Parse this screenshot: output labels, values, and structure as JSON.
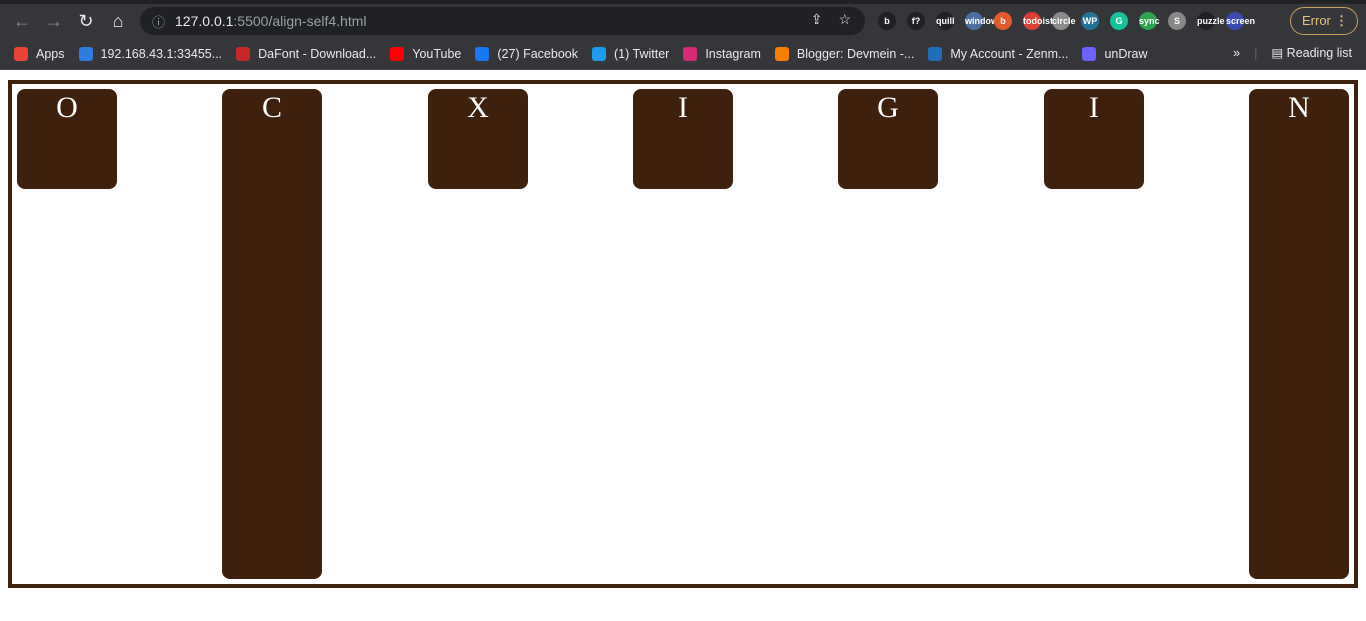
{
  "browser": {
    "url_host": "127.0.0.1",
    "url_path": ":5500/align-self4.html",
    "error_label": "Error",
    "extensions": [
      "b",
      "f?",
      "quill",
      "window",
      "b",
      "todoist",
      "circle",
      "WP",
      "G",
      "sync",
      "S",
      "puzzle",
      "screen"
    ],
    "bookmarks": [
      {
        "label": "Apps",
        "icon": "apps-grid-icon",
        "color": "#ea4335"
      },
      {
        "label": "192.168.43.1:33455...",
        "icon": "xender-icon",
        "color": "#2f7de1"
      },
      {
        "label": "DaFont - Download...",
        "icon": "dafont-icon",
        "color": "#c62828"
      },
      {
        "label": "YouTube",
        "icon": "youtube-icon",
        "color": "#ff0000"
      },
      {
        "label": "(27) Facebook",
        "icon": "facebook-icon",
        "color": "#1877f2"
      },
      {
        "label": "(1) Twitter",
        "icon": "twitter-icon",
        "color": "#1d9bf0"
      },
      {
        "label": "Instagram",
        "icon": "instagram-icon",
        "color": "#d62976"
      },
      {
        "label": "Blogger: Devmein -...",
        "icon": "blogger-icon",
        "color": "#f57d00"
      },
      {
        "label": "My Account - Zenm...",
        "icon": "zenmate-shield-icon",
        "color": "#1e6fb8"
      },
      {
        "label": "unDraw",
        "icon": "undraw-icon",
        "color": "#6c63ff"
      }
    ],
    "more_label": "»",
    "reading_list": "Reading list"
  },
  "page": {
    "accent": "#3e200c",
    "items": [
      {
        "letter": "O",
        "stretch": false
      },
      {
        "letter": "C",
        "stretch": true
      },
      {
        "letter": "X",
        "stretch": false
      },
      {
        "letter": "I",
        "stretch": false
      },
      {
        "letter": "G",
        "stretch": false
      },
      {
        "letter": "I",
        "stretch": false
      },
      {
        "letter": "N",
        "stretch": true
      }
    ]
  }
}
